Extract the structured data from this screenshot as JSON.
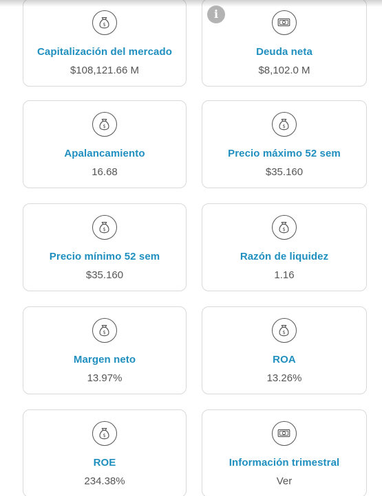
{
  "info_badge": "i",
  "colors": {
    "title": "#1f8fbf",
    "value": "#555555",
    "border": "#d9d9d9",
    "badge": "#b3b3b3"
  },
  "cards": [
    {
      "title": "Capitalización del mercado",
      "value": "$108,121.66 M",
      "icon": "money-bag-icon"
    },
    {
      "title": "Deuda neta",
      "value": "$8,102.0 M",
      "icon": "banknote-icon"
    },
    {
      "title": "Apalancamiento",
      "value": "16.68",
      "icon": "money-bag-icon"
    },
    {
      "title": "Precio máximo 52 sem",
      "value": "$35.160",
      "icon": "money-bag-icon"
    },
    {
      "title": "Precio mínimo 52 sem",
      "value": "$35.160",
      "icon": "money-bag-icon"
    },
    {
      "title": "Razón de liquidez",
      "value": "1.16",
      "icon": "money-bag-icon"
    },
    {
      "title": "Margen neto",
      "value": "13.97%",
      "icon": "money-bag-icon"
    },
    {
      "title": "ROA",
      "value": "13.26%",
      "icon": "money-bag-icon"
    },
    {
      "title": "ROE",
      "value": "234.38%",
      "icon": "money-bag-icon"
    },
    {
      "title": "Información trimestral",
      "value": "Ver",
      "icon": "banknote-icon"
    }
  ]
}
